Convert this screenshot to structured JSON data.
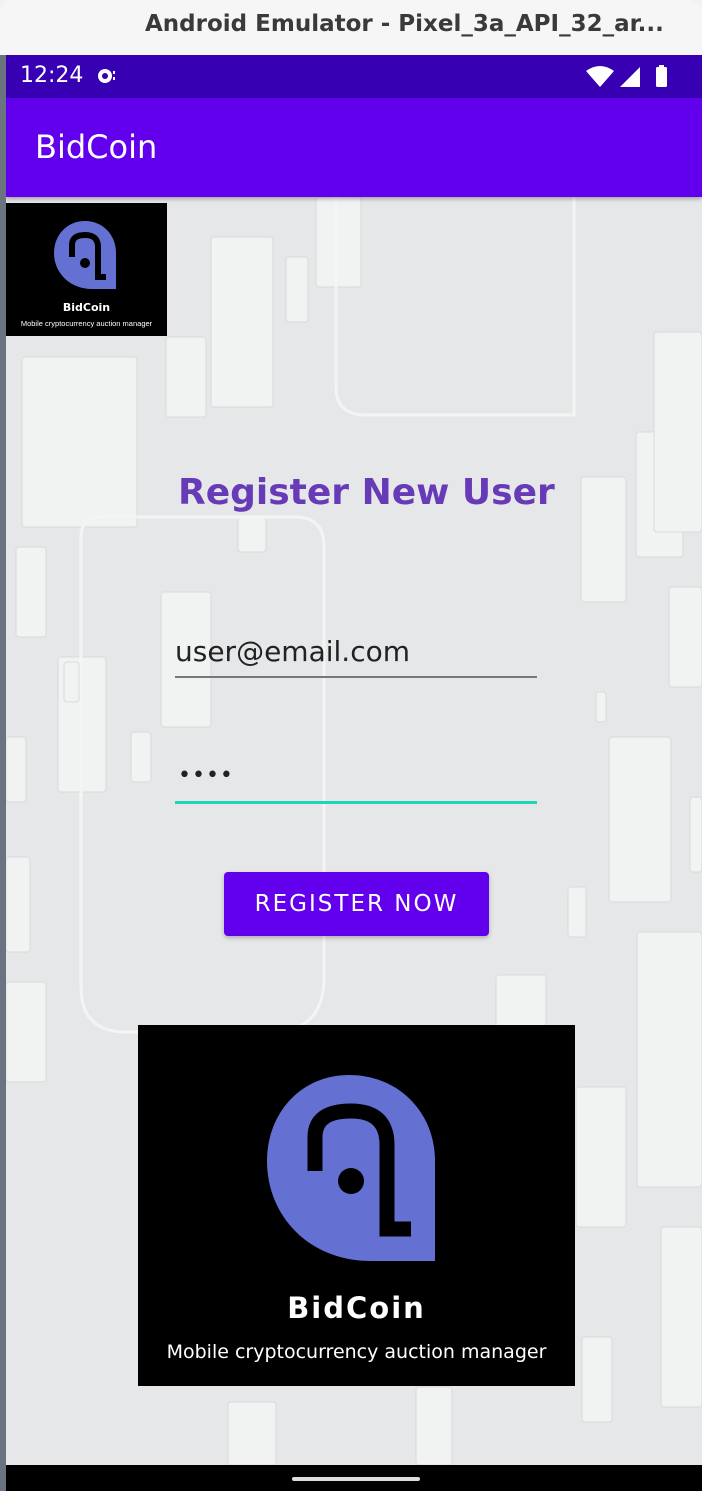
{
  "window": {
    "title": "Android Emulator - Pixel_3a_API_32_ar..."
  },
  "status_bar": {
    "time": "12:24"
  },
  "app_bar": {
    "title": "BidCoin"
  },
  "logo": {
    "name": "BidCoin",
    "tagline": "Mobile cryptocurrency auction manager"
  },
  "form": {
    "heading": "Register New User",
    "email_value": "user@email.com",
    "password_mask": "••••",
    "register_label": "Register Now"
  },
  "colors": {
    "primary": "#6200ee",
    "primary_dark": "#3700b3",
    "heading": "#673ab7",
    "focus_underline": "#1ed6b6",
    "logo_accent": "#6471d2"
  }
}
